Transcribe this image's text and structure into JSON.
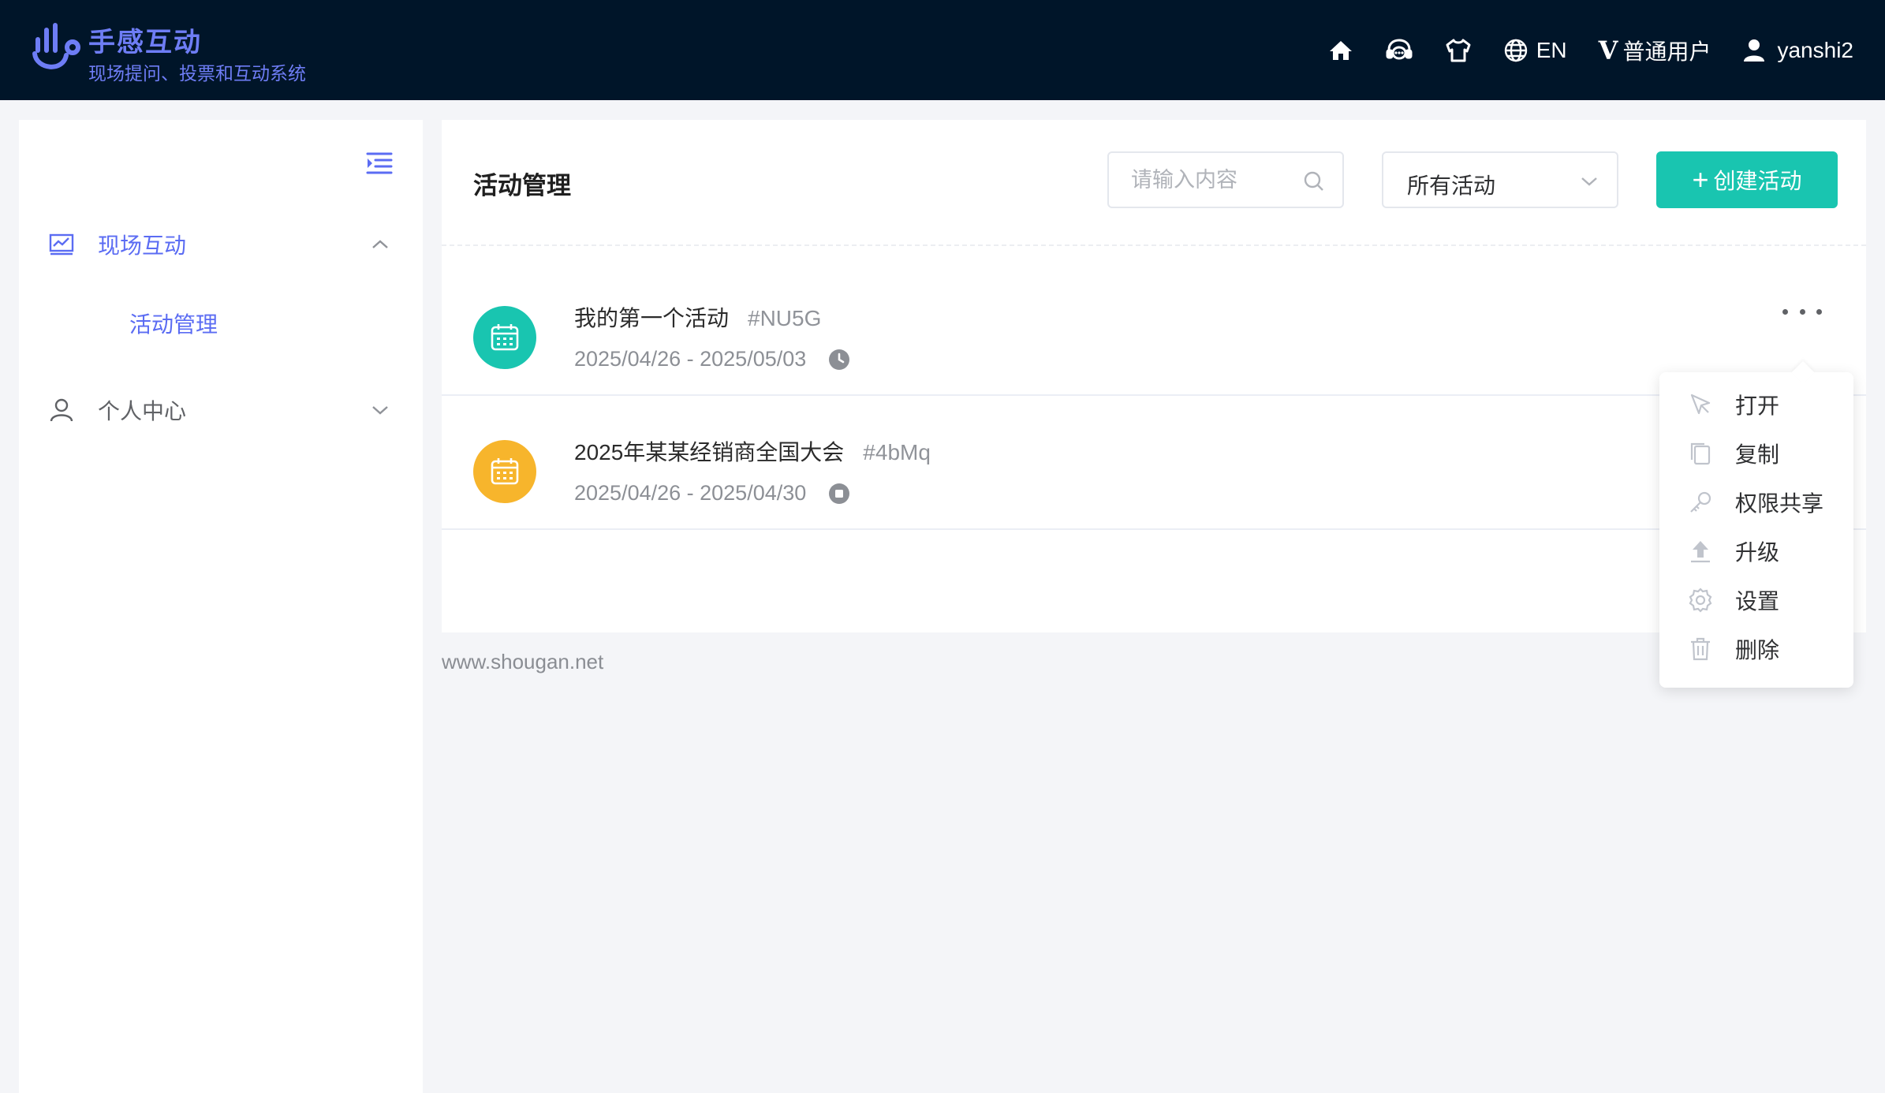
{
  "brand": {
    "title": "手感互动",
    "subtitle": "现场提问、投票和互动系统",
    "color": "#6e7df5"
  },
  "topnav": {
    "language": "EN",
    "plan_badge": "V",
    "plan": "普通用户",
    "username": "yanshi2"
  },
  "sidebar": {
    "groups": [
      {
        "label": "现场互动",
        "icon": "chart-icon",
        "expanded": true,
        "children": [
          {
            "label": "活动管理",
            "active": true
          }
        ]
      },
      {
        "label": "个人中心",
        "icon": "user-icon",
        "expanded": false
      }
    ]
  },
  "main": {
    "title": "活动管理",
    "search_placeholder": "请输入内容",
    "filter_selected": "所有活动",
    "create_label": "创建活动",
    "events": [
      {
        "name": "我的第一个活动",
        "code": "#NU5G",
        "dates": "2025/04/26 - 2025/05/03",
        "status": "clock",
        "color": "#19c5b0"
      },
      {
        "name": "2025年某某经销商全国大会",
        "code": "#4bMq",
        "dates": "2025/04/26 - 2025/04/30",
        "status": "stopped",
        "color": "#f7b52c"
      }
    ]
  },
  "menu": {
    "items": [
      {
        "label": "打开",
        "icon": "cursor-icon"
      },
      {
        "label": "复制",
        "icon": "copy-icon"
      },
      {
        "label": "权限共享",
        "icon": "key-icon"
      },
      {
        "label": "升级",
        "icon": "upload-icon"
      },
      {
        "label": "设置",
        "icon": "gear-icon"
      },
      {
        "label": "删除",
        "icon": "trash-icon"
      }
    ]
  },
  "footer": {
    "link": "www.shougan.net"
  },
  "colors": {
    "accent": "#19c5b0",
    "topbar": "#001529",
    "link": "#5b6cf3"
  }
}
